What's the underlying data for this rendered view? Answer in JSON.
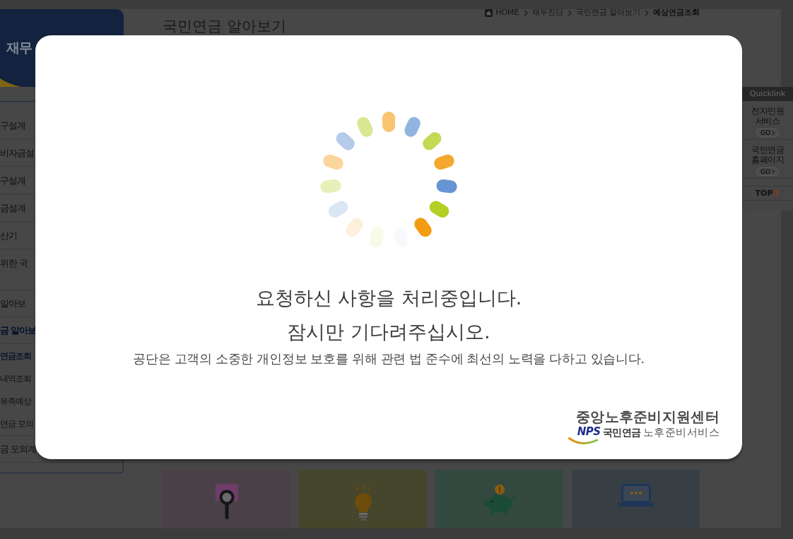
{
  "breadcrumb": [
    {
      "kind": "home",
      "label": "HOME",
      "current": false
    },
    {
      "kind": "link",
      "label": "재무진단",
      "current": false
    },
    {
      "kind": "link",
      "label": "국민연금 알아보기",
      "current": false
    },
    {
      "kind": "link",
      "label": "예상연금조회",
      "current": true
    }
  ],
  "page_title": "국민연금 알아보기",
  "sidebar": {
    "title": "재무",
    "groups": [
      {
        "items": [
          {
            "label": "구설계",
            "selected": false
          },
          {
            "label": "비자금설",
            "selected": false
          },
          {
            "label": "구설계",
            "selected": false
          },
          {
            "label": "금설계",
            "selected": false
          },
          {
            "label": "산기",
            "selected": false
          },
          {
            "label": "위한 국",
            "selected": false
          }
        ]
      },
      {
        "items": [
          {
            "label": "알아보",
            "selected": false
          },
          {
            "label": "금 알아보",
            "selected": true,
            "children": [
              {
                "label": "연금조회",
                "selected": true
              },
              {
                "label": "내역조회",
                "selected": false
              },
              {
                "label": "유족예상",
                "selected": false
              },
              {
                "label": "연금 모의",
                "selected": false
              }
            ]
          },
          {
            "label": "금 모의계",
            "selected": false
          }
        ]
      }
    ]
  },
  "tiles": [
    {
      "kind": "search",
      "color": "#4a4148"
    },
    {
      "kind": "idea",
      "color": "#45462b"
    },
    {
      "kind": "savings",
      "color": "#33493f"
    },
    {
      "kind": "laptop",
      "color": "#373f45"
    }
  ],
  "quicklink": {
    "title": "Quicklink",
    "links": [
      {
        "label": "전자민원 서비스",
        "button": "GO"
      },
      {
        "label": "국민연금 홈페이지",
        "button": "GO"
      }
    ],
    "top": "TOP"
  },
  "dialog": {
    "messages": [
      "요청하신 사항을 처리중입니다.",
      "잠시만 기다려주십시오."
    ],
    "notice": "공단은 고객의 소중한 개인정보 보호를 위해 관련 법 준수에 최선의 노력을 다하고 있습니다.",
    "logo": {
      "title": "중앙노후준비지원센터",
      "brand": "NPS",
      "org": "국민연금",
      "service": "노후준비서비스"
    }
  }
}
